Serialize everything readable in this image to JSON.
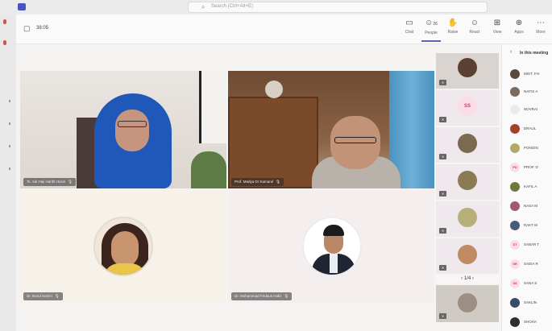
{
  "search": {
    "placeholder": "Search (Ctrl+Alt+E)"
  },
  "meeting": {
    "time": "38:05"
  },
  "toolbar": [
    {
      "label": "Chat",
      "icon": "chat-icon"
    },
    {
      "label": "People",
      "count": "26",
      "icon": "people-icon"
    },
    {
      "label": "Raise",
      "icon": "raise-hand-icon"
    },
    {
      "label": "React",
      "icon": "react-icon"
    },
    {
      "label": "View",
      "icon": "view-icon"
    },
    {
      "label": "Apps",
      "icon": "apps-icon"
    },
    {
      "label": "More",
      "icon": "more-icon"
    }
  ],
  "stage": {
    "tiles": [
      {
        "name": "Ts. Adi Haji Harith Husin"
      },
      {
        "name": "Prof. Madya Dr Kamarul"
      },
      {
        "name": "Dr. Nurul Hanim"
      },
      {
        "name": "Dr. Mohammad Firdaus Hafiz"
      }
    ]
  },
  "strip": {
    "initials": "SS",
    "pager": "1/4"
  },
  "panel": {
    "title": "In this meeting",
    "participants": [
      {
        "name": "MIST. FAI"
      },
      {
        "name": "NAFIS A"
      },
      {
        "name": "NOVRAI"
      },
      {
        "name": "DRAUL"
      },
      {
        "name": "PONGIN"
      },
      {
        "name": "PROF. D",
        "initials": "PD"
      },
      {
        "name": "KAFIL A"
      },
      {
        "name": "NASA M"
      },
      {
        "name": "RAKT M"
      },
      {
        "name": "SABAR T",
        "initials": "ST"
      },
      {
        "name": "SADIA R",
        "initials": "SR"
      },
      {
        "name": "SANA S",
        "initials": "SS"
      },
      {
        "name": "SAKLIN"
      },
      {
        "name": "SHOHA"
      }
    ]
  },
  "colors": {
    "accent": "#6264a7",
    "initials_bg": "#fbdde6",
    "initials_fg": "#c2416c"
  }
}
